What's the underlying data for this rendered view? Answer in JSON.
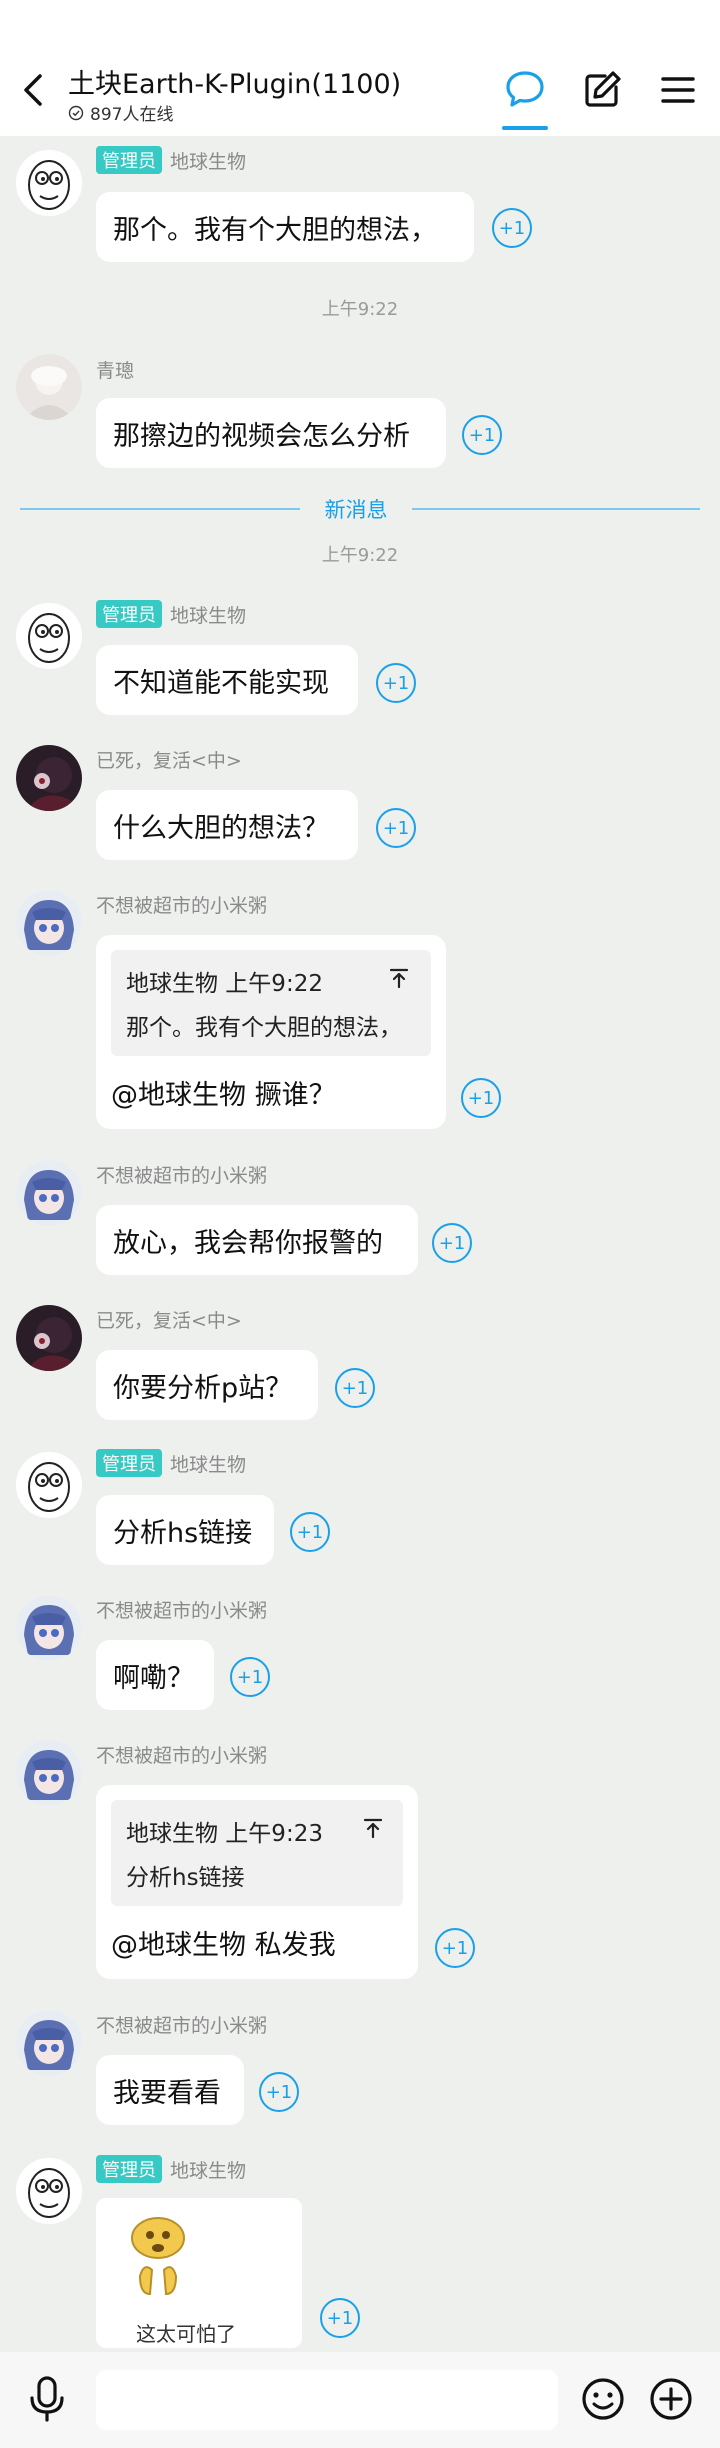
{
  "header": {
    "title": "土块Earth-K-Plugin(1100)",
    "online": "897人在线"
  },
  "plus_one": "+1",
  "badges": {
    "admin": "管理员"
  },
  "divider": {
    "new_messages": "新消息"
  },
  "messages": [
    {
      "sender": "地球生物",
      "text": "那个。我有个大胆的想法，"
    },
    {
      "time": "上午9:22"
    },
    {
      "sender": "青璁",
      "text": "那擦边的视频会怎么分析"
    },
    {
      "time": "上午9:22"
    },
    {
      "sender": "地球生物",
      "text": "不知道能不能实现"
    },
    {
      "sender": "已死，复活<中>",
      "text": "什么大胆的想法？"
    },
    {
      "sender": "不想被超市的小米粥",
      "quote_head": "地球生物 上午9:22",
      "quote_text": "那个。我有个大胆的想法，",
      "text": "@地球生物 撅谁？"
    },
    {
      "sender": "不想被超市的小米粥",
      "text": "放心，我会帮你报警的"
    },
    {
      "sender": "已死，复活<中>",
      "text": "你要分析p站？"
    },
    {
      "sender": "地球生物",
      "text": "分析hs链接"
    },
    {
      "sender": "不想被超市的小米粥",
      "text": "啊嘞？"
    },
    {
      "sender": "不想被超市的小米粥",
      "quote_head": "地球生物 上午9:23",
      "quote_text": "分析hs链接",
      "text": "@地球生物 私发我"
    },
    {
      "sender": "不想被超市的小米粥",
      "text": "我要看看"
    },
    {
      "sender": "地球生物",
      "sticker_caption": "这太可怕了"
    }
  ]
}
